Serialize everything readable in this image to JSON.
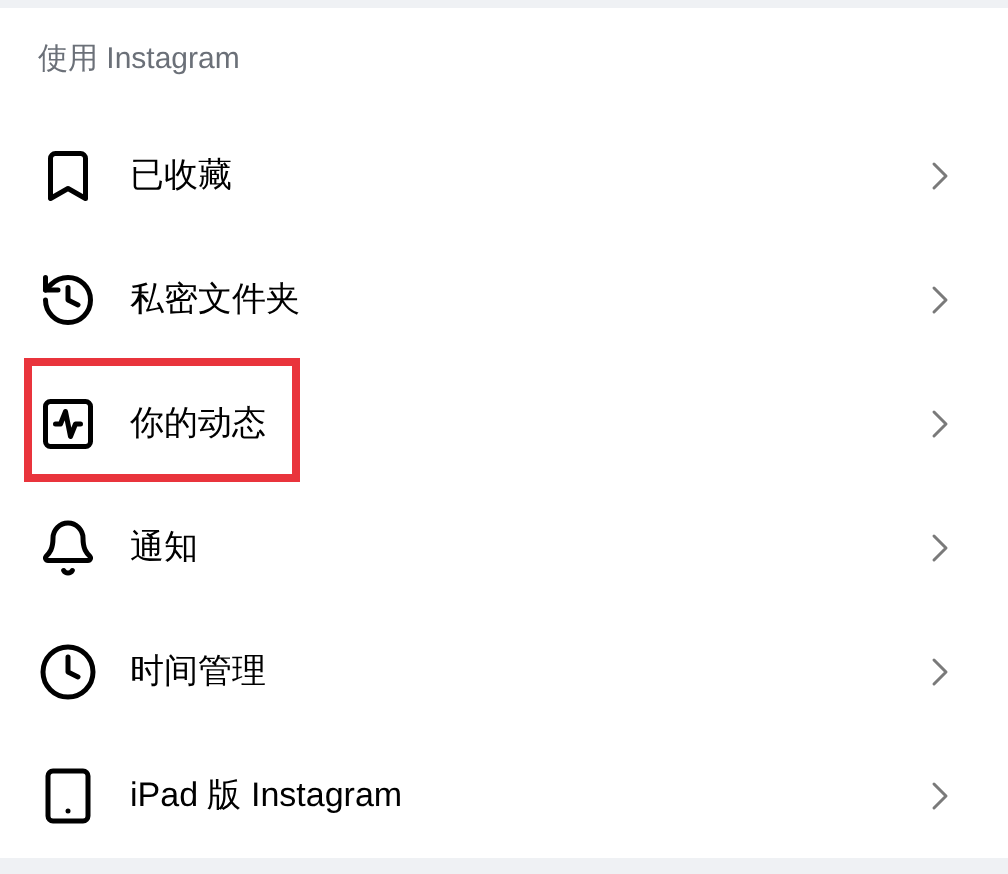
{
  "section": {
    "title": "使用 Instagram"
  },
  "items": [
    {
      "kind": "saved",
      "label": "已收藏",
      "highlighted": false
    },
    {
      "kind": "archive",
      "label": "私密文件夹",
      "highlighted": false
    },
    {
      "kind": "activity",
      "label": "你的动态",
      "highlighted": true
    },
    {
      "kind": "notifications",
      "label": "通知",
      "highlighted": false
    },
    {
      "kind": "time",
      "label": "时间管理",
      "highlighted": false
    },
    {
      "kind": "tablet",
      "label": "iPad 版 Instagram",
      "highlighted": false
    }
  ]
}
